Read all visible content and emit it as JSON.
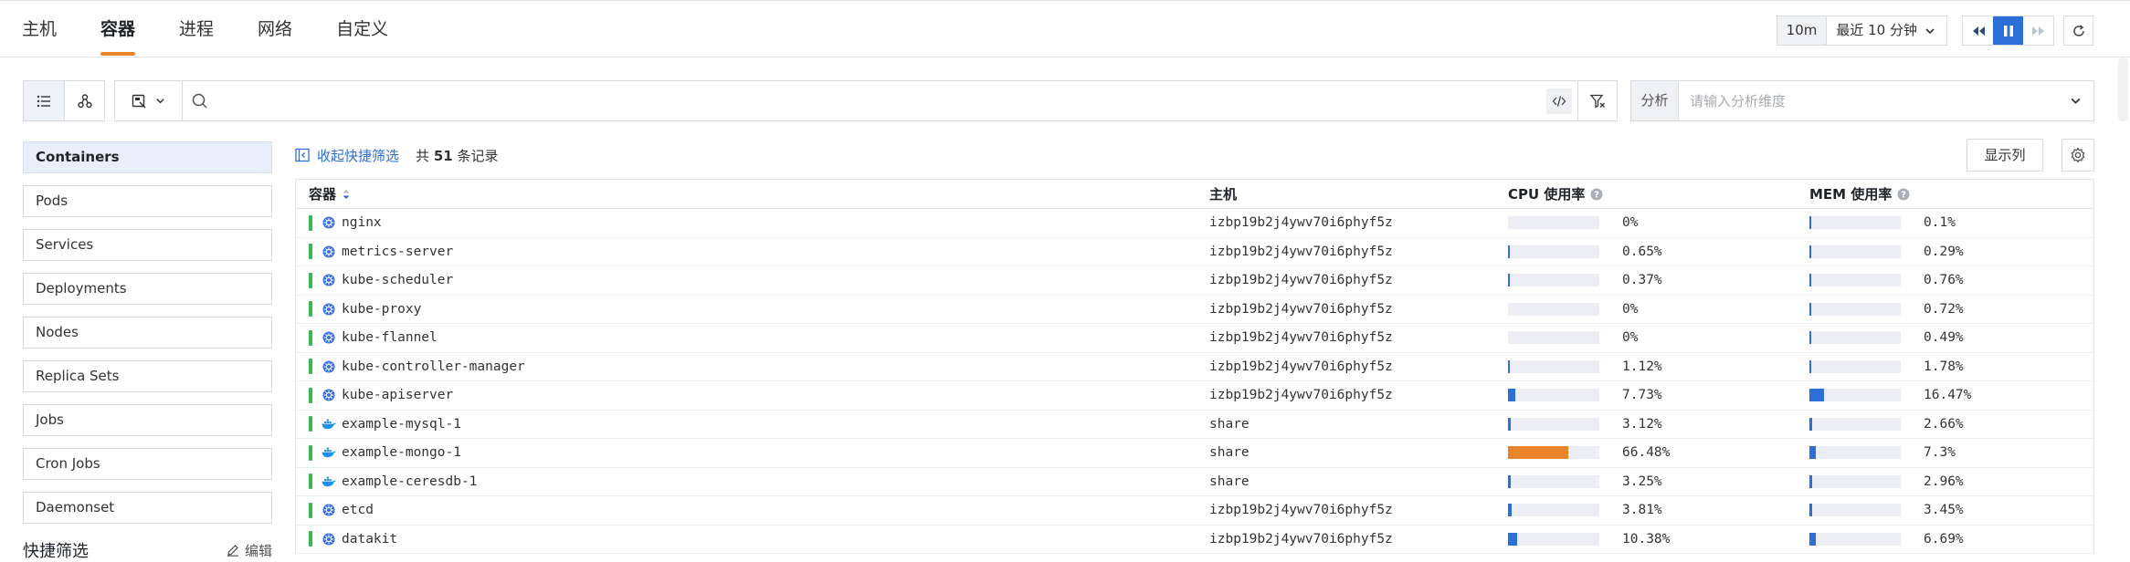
{
  "tabs": [
    {
      "label": "主机",
      "active": false
    },
    {
      "label": "容器",
      "active": true
    },
    {
      "label": "进程",
      "active": false
    },
    {
      "label": "网络",
      "active": false
    },
    {
      "label": "自定义",
      "active": false
    }
  ],
  "time": {
    "tag": "10m",
    "range": "最近 10 分钟"
  },
  "analysis": {
    "label": "分析",
    "placeholder": "请输入分析维度"
  },
  "sidebar": {
    "items": [
      {
        "label": "Containers",
        "active": true
      },
      {
        "label": "Pods"
      },
      {
        "label": "Services"
      },
      {
        "label": "Deployments"
      },
      {
        "label": "Nodes"
      },
      {
        "label": "Replica Sets"
      },
      {
        "label": "Jobs"
      },
      {
        "label": "Cron Jobs"
      },
      {
        "label": "Daemonset"
      }
    ],
    "quick_filter": {
      "title": "快捷筛选",
      "edit": "编辑"
    }
  },
  "toolbar": {
    "collapse_label": "收起快捷筛选",
    "count_prefix": "共",
    "count": "51",
    "count_suffix": "条记录",
    "show_columns": "显示列"
  },
  "table": {
    "headers": {
      "name": "容器",
      "host": "主机",
      "cpu": "CPU 使用率",
      "mem": "MEM 使用率"
    },
    "rows": [
      {
        "name": "nginx",
        "icon": "kubernetes-icon",
        "host": "izbp19b2j4ywv70i6phyf5z",
        "cpu": "0%",
        "cpu_pct": 0,
        "mem": "0.1%",
        "mem_pct": 0.1
      },
      {
        "name": "metrics-server",
        "icon": "kubernetes-icon",
        "host": "izbp19b2j4ywv70i6phyf5z",
        "cpu": "0.65%",
        "cpu_pct": 0.65,
        "mem": "0.29%",
        "mem_pct": 0.29
      },
      {
        "name": "kube-scheduler",
        "icon": "kubernetes-icon",
        "host": "izbp19b2j4ywv70i6phyf5z",
        "cpu": "0.37%",
        "cpu_pct": 0.37,
        "mem": "0.76%",
        "mem_pct": 0.76
      },
      {
        "name": "kube-proxy",
        "icon": "kubernetes-icon",
        "host": "izbp19b2j4ywv70i6phyf5z",
        "cpu": "0%",
        "cpu_pct": 0,
        "mem": "0.72%",
        "mem_pct": 0.72
      },
      {
        "name": "kube-flannel",
        "icon": "kubernetes-icon",
        "host": "izbp19b2j4ywv70i6phyf5z",
        "cpu": "0%",
        "cpu_pct": 0,
        "mem": "0.49%",
        "mem_pct": 0.49
      },
      {
        "name": "kube-controller-manager",
        "icon": "kubernetes-icon",
        "host": "izbp19b2j4ywv70i6phyf5z",
        "cpu": "1.12%",
        "cpu_pct": 1.12,
        "mem": "1.78%",
        "mem_pct": 1.78
      },
      {
        "name": "kube-apiserver",
        "icon": "kubernetes-icon",
        "host": "izbp19b2j4ywv70i6phyf5z",
        "cpu": "7.73%",
        "cpu_pct": 7.73,
        "mem": "16.47%",
        "mem_pct": 16.47
      },
      {
        "name": "example-mysql-1",
        "icon": "docker-icon",
        "host": "share",
        "cpu": "3.12%",
        "cpu_pct": 3.12,
        "mem": "2.66%",
        "mem_pct": 2.66
      },
      {
        "name": "example-mongo-1",
        "icon": "docker-icon",
        "host": "share",
        "cpu": "66.48%",
        "cpu_pct": 66.48,
        "mem": "7.3%",
        "mem_pct": 7.3
      },
      {
        "name": "example-ceresdb-1",
        "icon": "docker-icon",
        "host": "share",
        "cpu": "3.25%",
        "cpu_pct": 3.25,
        "mem": "2.96%",
        "mem_pct": 2.96
      },
      {
        "name": "etcd",
        "icon": "kubernetes-icon",
        "host": "izbp19b2j4ywv70i6phyf5z",
        "cpu": "3.81%",
        "cpu_pct": 3.81,
        "mem": "3.45%",
        "mem_pct": 3.45
      },
      {
        "name": "datakit",
        "icon": "kubernetes-icon",
        "host": "izbp19b2j4ywv70i6phyf5z",
        "cpu": "10.38%",
        "cpu_pct": 10.38,
        "mem": "6.69%",
        "mem_pct": 6.69
      }
    ]
  },
  "colors": {
    "accent": "#e8852a",
    "primary": "#2e6ed7",
    "status_ok": "#3bb856",
    "bar_track": "#eceef4"
  }
}
